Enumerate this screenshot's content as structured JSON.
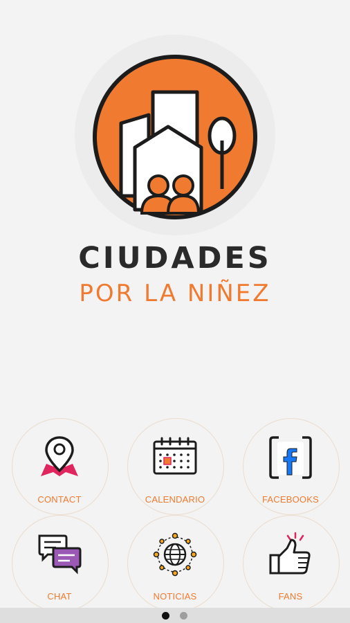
{
  "brand": {
    "title": "CIUDADES",
    "subtitle": "POR LA NIÑEZ",
    "accent_color": "#f07a2f",
    "logo_icon": "city-children-logo"
  },
  "menu": {
    "items": [
      {
        "label": "CONTACT",
        "icon": "location-map-icon"
      },
      {
        "label": "CALENDARIO",
        "icon": "calendar-icon"
      },
      {
        "label": "FACEBOOKS",
        "icon": "facebook-icon"
      },
      {
        "label": "CHAT",
        "icon": "chat-bubbles-icon"
      },
      {
        "label": "NOTICIAS",
        "icon": "globe-network-icon"
      },
      {
        "label": "FANS",
        "icon": "thumbs-up-icon"
      }
    ]
  },
  "pager": {
    "pages": 2,
    "current": 1
  }
}
